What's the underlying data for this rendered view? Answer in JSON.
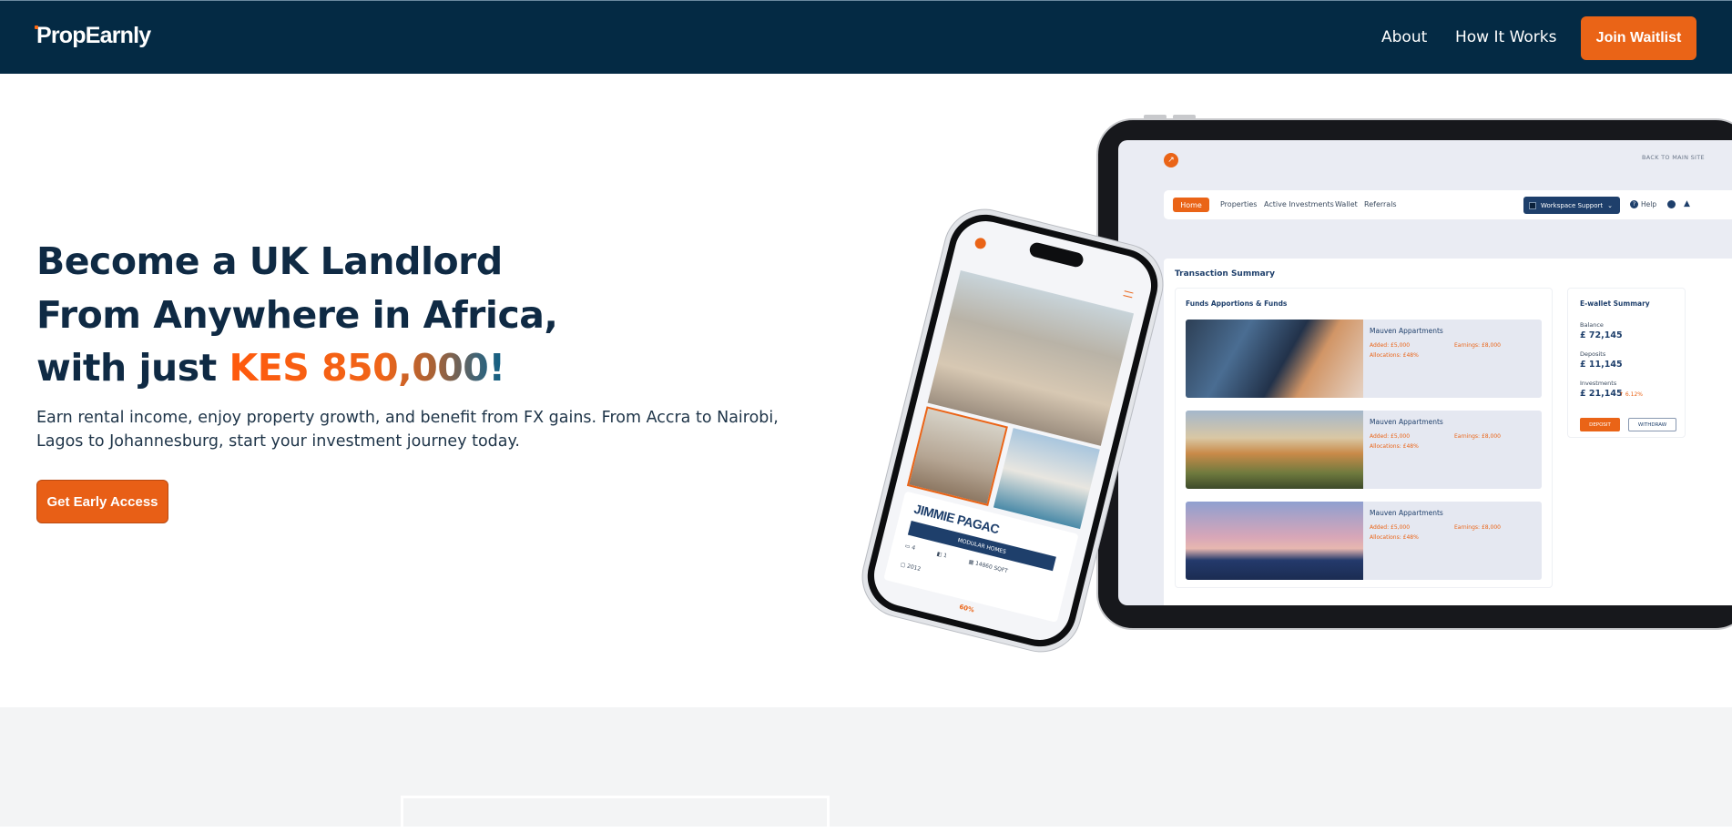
{
  "nav": {
    "logo": "PropEarnly",
    "links": [
      "About",
      "How It Works"
    ],
    "cta": "Join Waitlist"
  },
  "hero": {
    "line1": "Become a UK Landlord",
    "line2": "From Anywhere in Africa,",
    "line3_prefix": "with just ",
    "line3_highlight": "KES 850,000!",
    "description": "Earn rental income, enjoy property growth, and benefit from FX gains. From Accra to Nairobi, Lagos to Johannesburg, start your investment journey today.",
    "cta": "Get Early Access"
  },
  "tablet": {
    "back_link": "BACK TO MAIN SITE",
    "menu": [
      "Home",
      "Properties",
      "Active Investments",
      "Wallet",
      "Referrals"
    ],
    "workspace": "Workspace Support",
    "help": "Help",
    "section_title": "Transaction Summary",
    "funds_title": "Funds Apportions & Funds",
    "properties": [
      {
        "name": "Mauven Appartments",
        "added": "Added: £5,000",
        "earnings": "Earnings: £8,000",
        "allocations": "Allocations: £48%"
      },
      {
        "name": "Mauven Appartments",
        "added": "Added: £5,000",
        "earnings": "Earnings: £8,000",
        "allocations": "Allocations: £48%"
      },
      {
        "name": "Mauven Appartments",
        "added": "Added: £5,000",
        "earnings": "Earnings: £8,000",
        "allocations": "Allocations: £48%"
      }
    ],
    "wallet": {
      "title": "E-wallet Summary",
      "balance_label": "Balance",
      "balance": "£ 72,145",
      "deposits_label": "Deposits",
      "deposits": "£ 11,145",
      "investments_label": "Investments",
      "investments": "£ 21,145",
      "change": "↑ 6.12%",
      "deposit_btn": "DEPOSIT",
      "withdraw_btn": "WITHDRAW"
    }
  },
  "phone": {
    "name": "JIMMIE PAGAC",
    "tag": "MODULAR HOMES",
    "beds": "4",
    "baths": "1",
    "area": "14860 SQFT",
    "year": "2012",
    "percent": "60%"
  },
  "colors": {
    "navy": "#042a44",
    "orange": "#ea6417"
  }
}
